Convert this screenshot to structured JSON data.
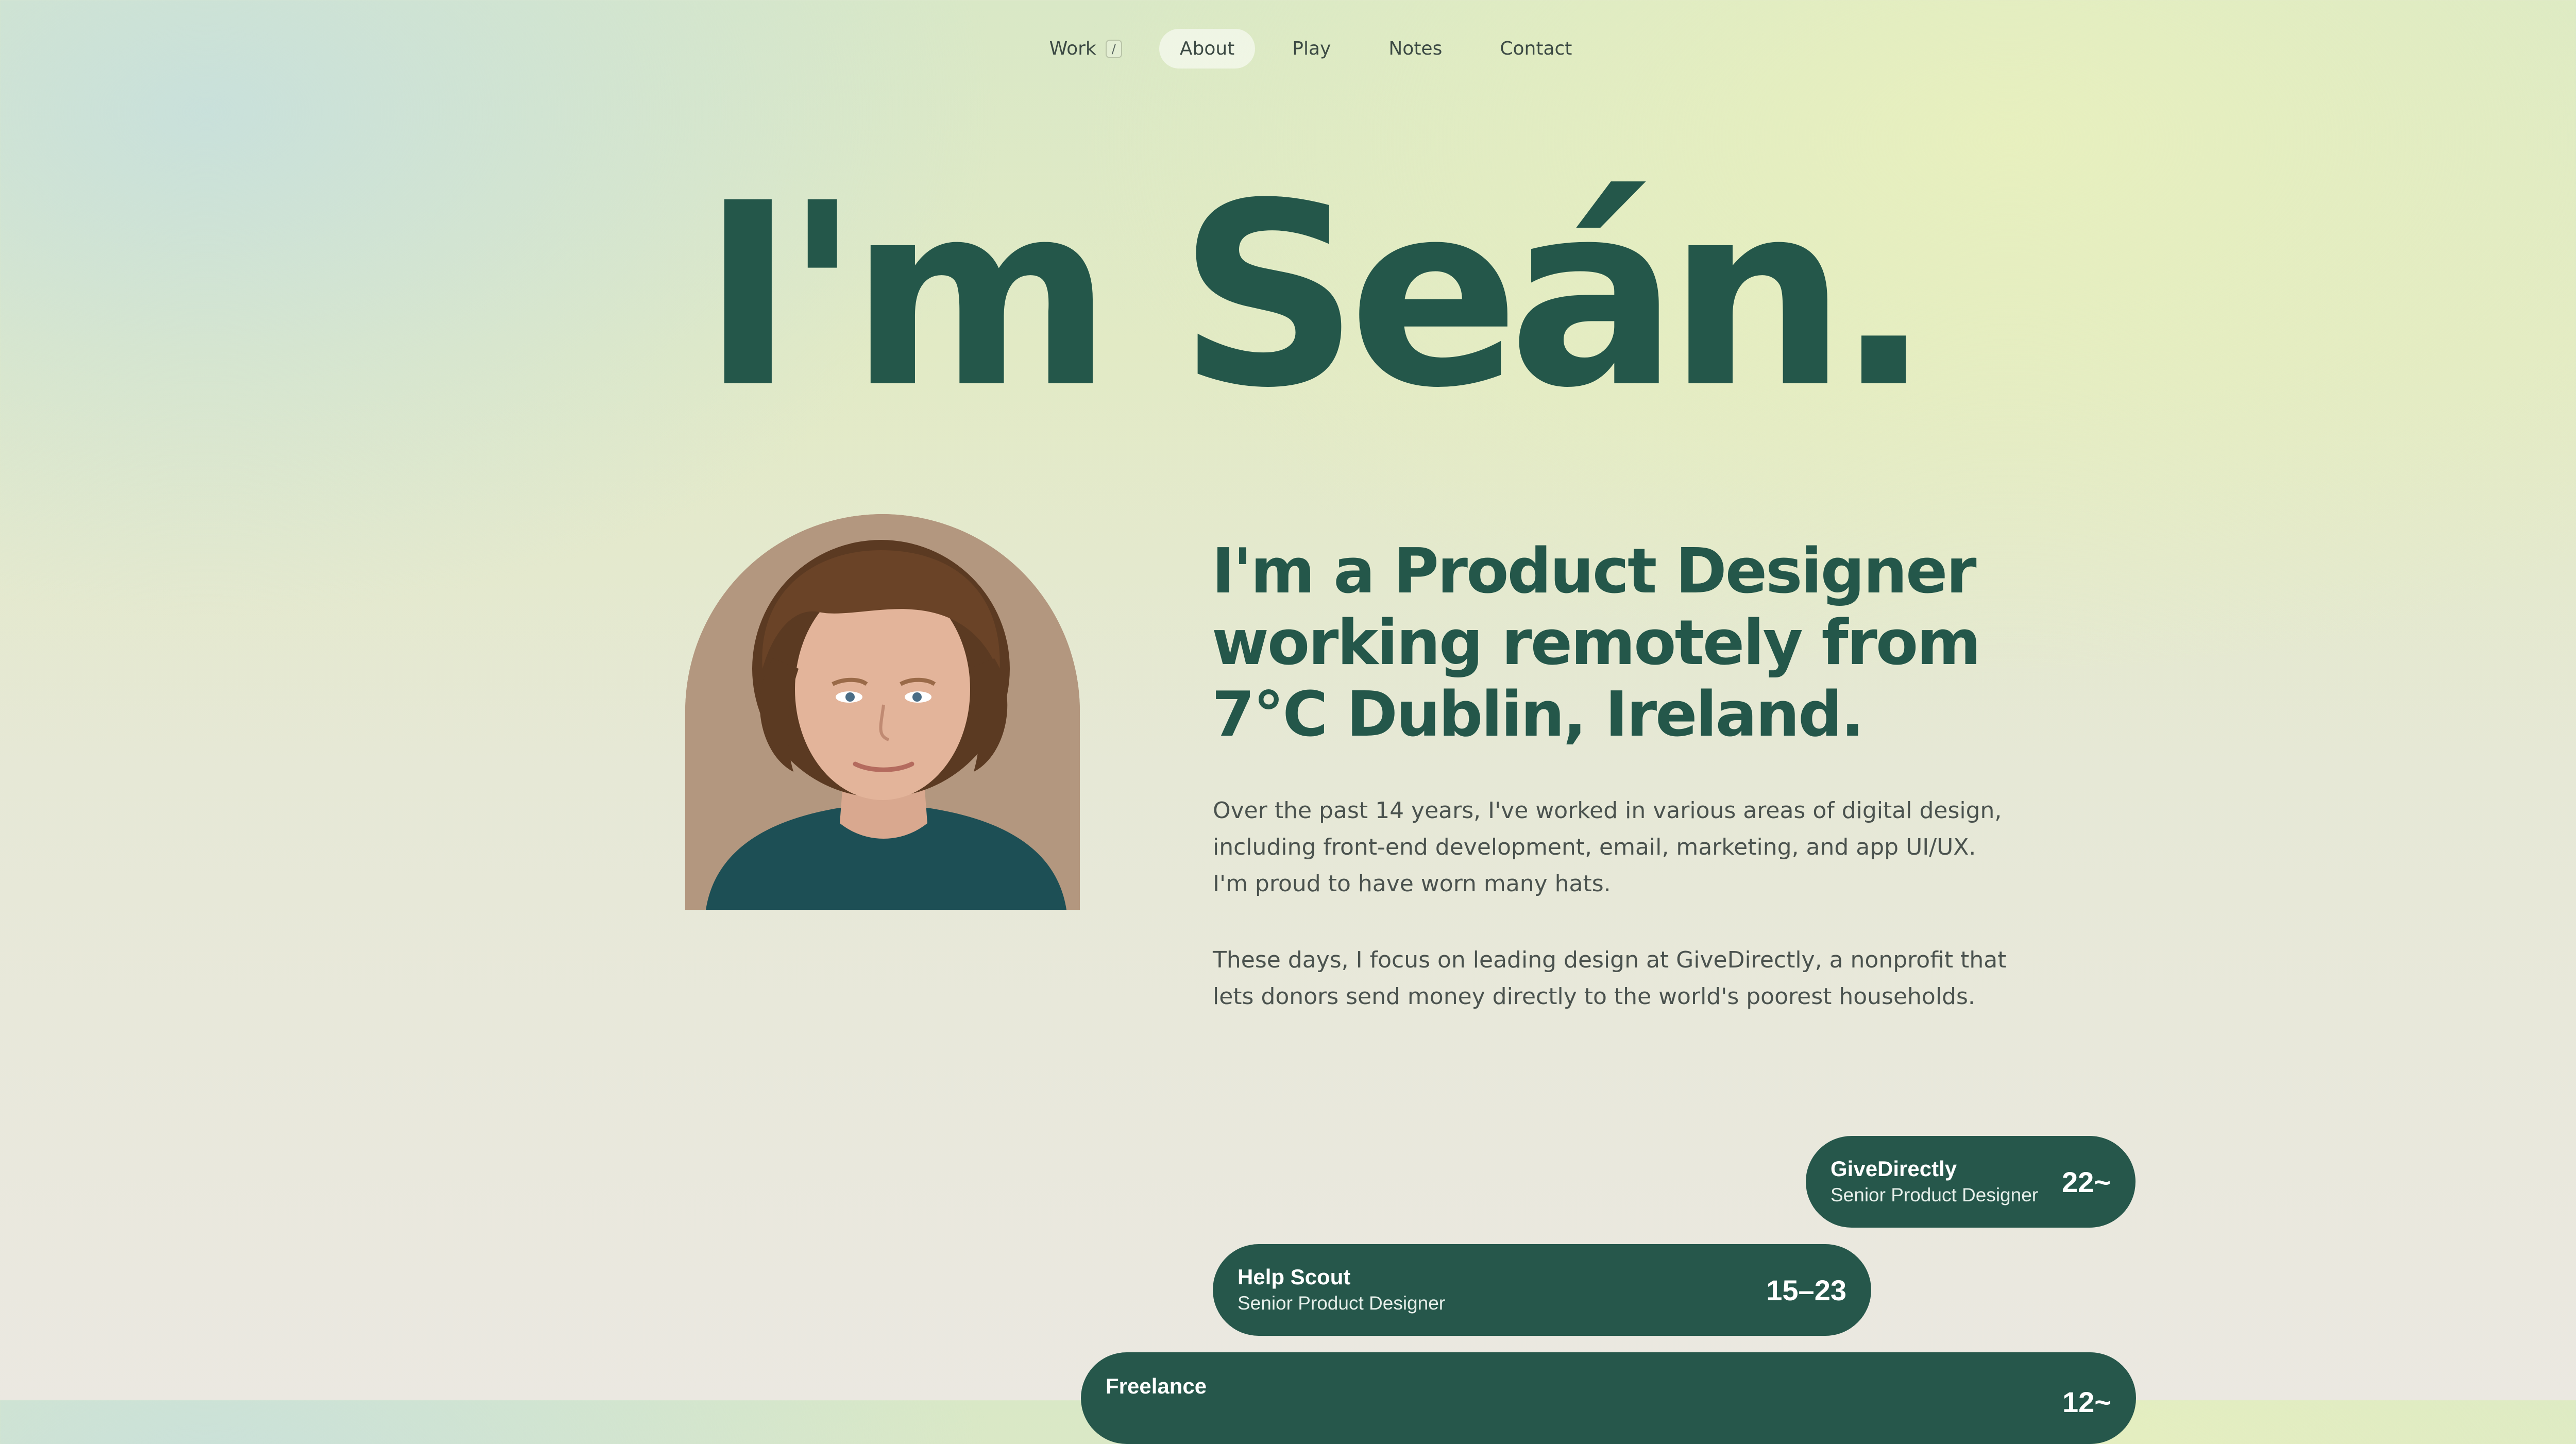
{
  "nav": {
    "items": [
      {
        "label": "Work",
        "shortcut": "/"
      },
      {
        "label": "About",
        "active": true
      },
      {
        "label": "Play"
      },
      {
        "label": "Notes"
      },
      {
        "label": "Contact"
      }
    ]
  },
  "hero": {
    "title": "I'm Seán."
  },
  "about": {
    "headline": "I'm a Product Designer working remotely from 7°C Dublin, Ireland.",
    "paragraph1": "Over the past 14 years, I've worked in various areas of digital design, including front-end development, email, marketing, and app UI/UX. I'm proud to have worn many hats.",
    "paragraph2": "These days, I focus on leading design at GiveDirectly, a nonprofit that lets donors send money directly to the world's poorest households."
  },
  "experience": [
    {
      "company": "GiveDirectly",
      "role": "Senior Product Designer",
      "years": "22~"
    },
    {
      "company": "Help Scout",
      "role": "Senior Product Designer",
      "years": "15–23"
    },
    {
      "company": "Freelance",
      "role": "",
      "years": "12~"
    }
  ],
  "colors": {
    "accent": "#24574a",
    "pill": "#26574b",
    "body_text": "#4a524e"
  }
}
